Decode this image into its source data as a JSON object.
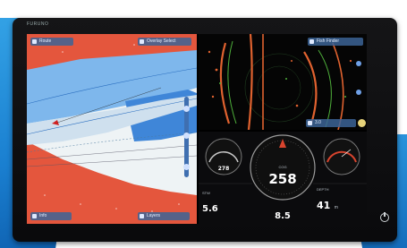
{
  "device": {
    "brand_text": "FURUNO"
  },
  "chart_pane": {
    "top_left_label": "Route",
    "top_right_label": "Overlay Select",
    "bottom_left_label": "Info",
    "bottom_right_label": "Layers"
  },
  "sonar_pane": {
    "top_right_label": "Fish Finder",
    "bottom_value": "3.0"
  },
  "instruments": {
    "gauge_small_left_value": "278",
    "compass_value": "258",
    "gauge_small_right_value": "",
    "depth_value": "41",
    "depth_unit": "m",
    "speed_a_value": "5.6",
    "speed_b_value": "8.5",
    "left_label": "STW",
    "center_label": "COG",
    "right_label": "DEPTH"
  },
  "colors": {
    "land": "#e4563d",
    "shallow": "#5da0e6",
    "accent_blue": "#2f7fd6",
    "sonar_orange": "#e0622f",
    "sonar_green": "#4fb03b"
  }
}
